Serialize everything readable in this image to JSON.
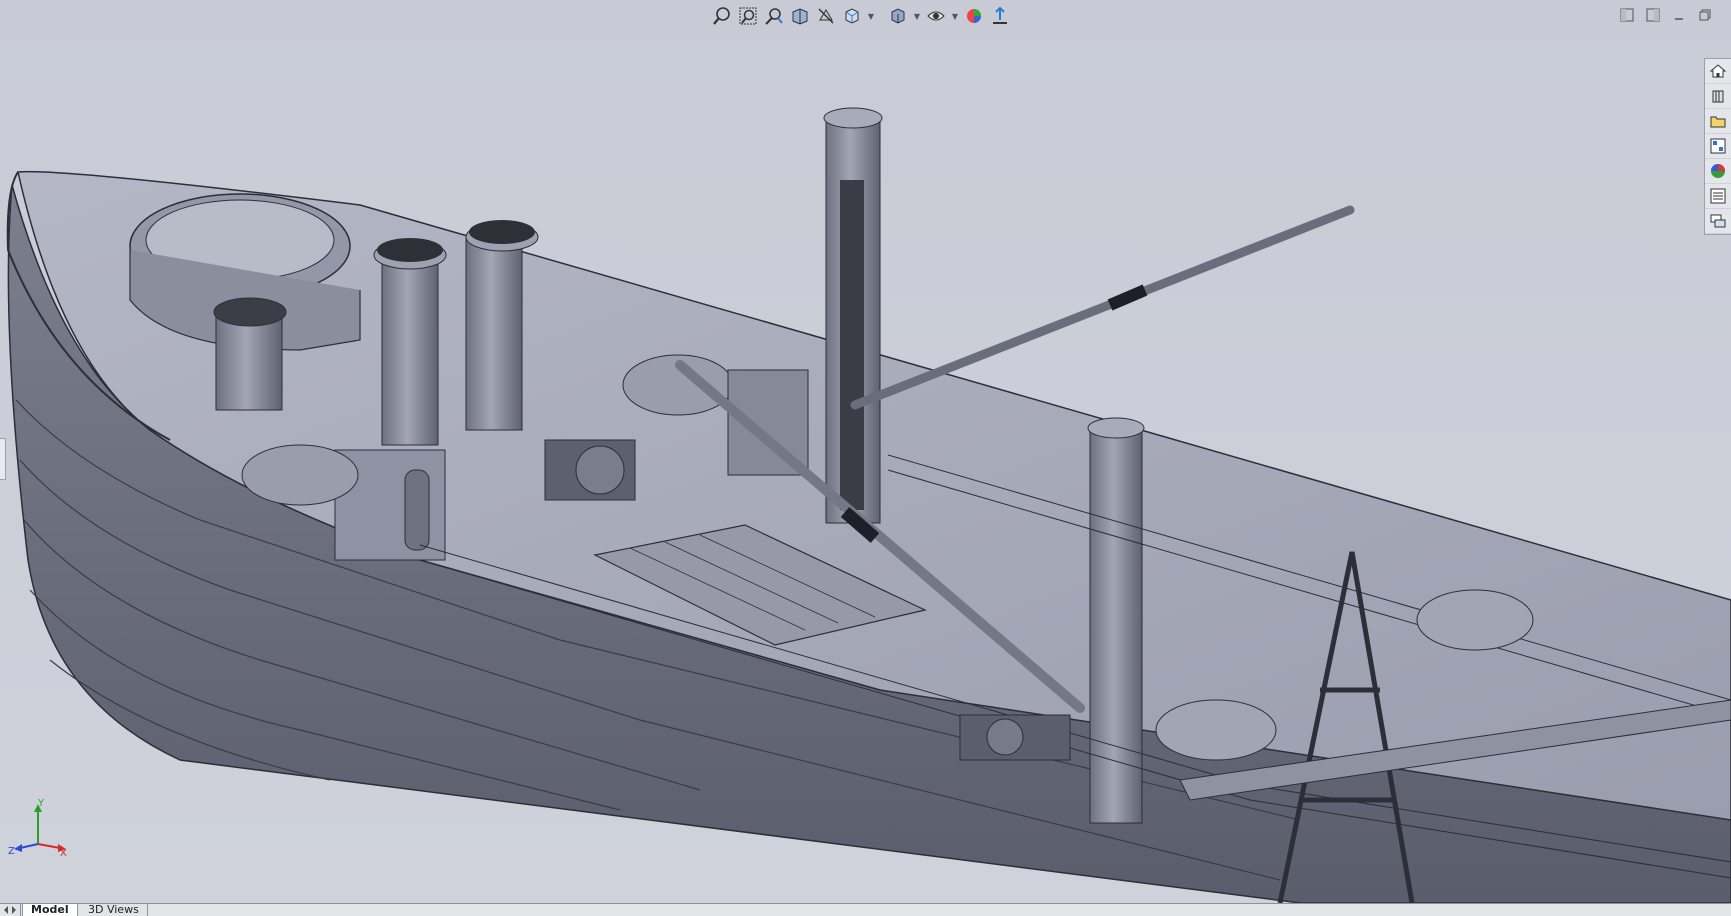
{
  "tabs": {
    "model": "Model",
    "views3d": "3D Views"
  },
  "triad": {
    "x": "X",
    "y": "Y",
    "z": "Z"
  },
  "colors": {
    "background": "#c9ccd6",
    "hull": "#6b6e7c",
    "deck": "#a9acbb",
    "structure": "#8d90a0",
    "edge": "#2c2e38",
    "axis_x": "#d42a2a",
    "axis_y": "#2aa02a",
    "axis_z": "#2a4ad4"
  },
  "icons": {
    "hud": [
      "zoom-to-fit-icon",
      "zoom-to-area-icon",
      "previous-view-icon",
      "section-view-icon",
      "dynamic-annotation-icon",
      "view-orientation-icon",
      "display-style-icon",
      "hide-show-items-icon",
      "edit-appearance-icon",
      "apply-scene-icon"
    ],
    "taskpane": [
      "solidworks-resources-icon",
      "design-library-icon",
      "file-explorer-icon",
      "view-palette-icon",
      "appearances-icon",
      "custom-properties-icon",
      "forum-icon"
    ],
    "window": [
      "tile-left-icon",
      "tile-right-icon",
      "minimize-icon",
      "restore-icon"
    ]
  }
}
